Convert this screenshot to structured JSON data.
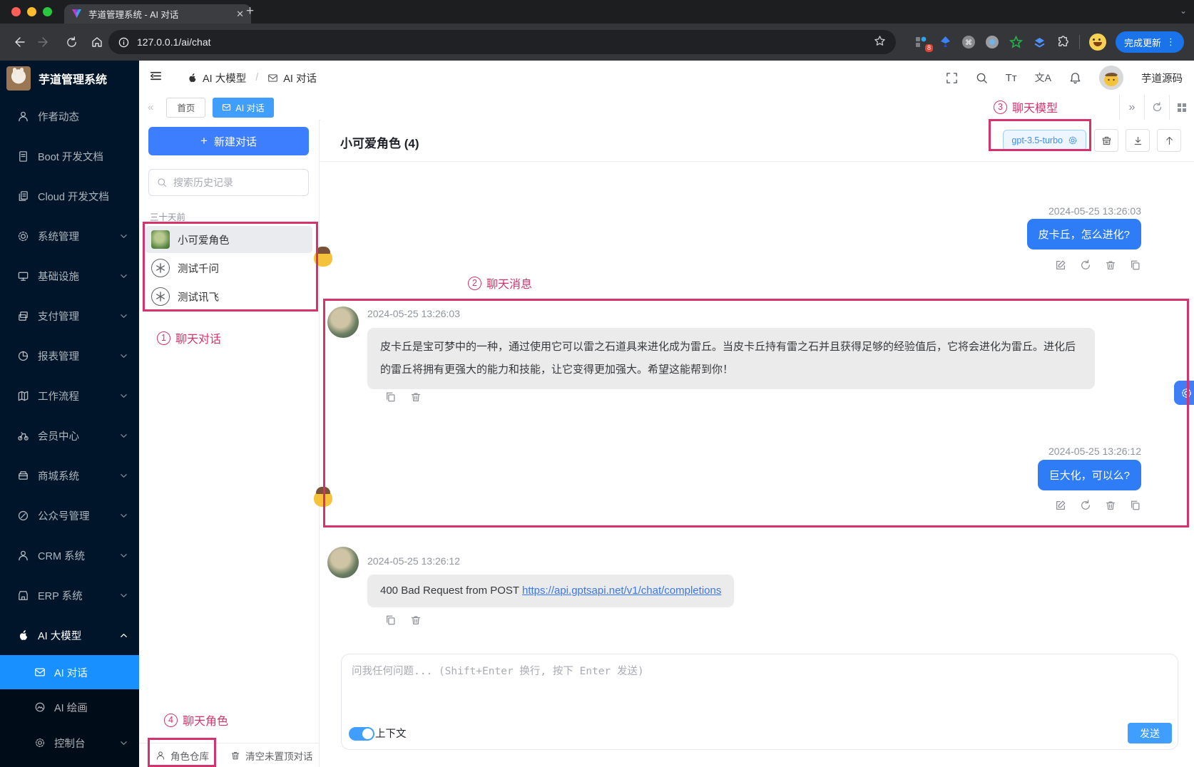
{
  "browser": {
    "tab_title": "芋道管理系统 - AI 对话",
    "url": "127.0.0.1/ai/chat",
    "update_button": "完成更新",
    "extension_badge": "8"
  },
  "sidebar": {
    "logo_title": "芋道管理系统",
    "items": [
      {
        "label": "作者动态"
      },
      {
        "label": "Boot 开发文档"
      },
      {
        "label": "Cloud 开发文档"
      },
      {
        "label": "系统管理"
      },
      {
        "label": "基础设施"
      },
      {
        "label": "支付管理"
      },
      {
        "label": "报表管理"
      },
      {
        "label": "工作流程"
      },
      {
        "label": "会员中心"
      },
      {
        "label": "商城系统"
      },
      {
        "label": "公众号管理"
      },
      {
        "label": "CRM 系统"
      },
      {
        "label": "ERP 系统"
      },
      {
        "label": "AI 大模型"
      }
    ],
    "submenu": [
      {
        "label": "AI 对话"
      },
      {
        "label": "AI 绘画"
      },
      {
        "label": "控制台"
      }
    ]
  },
  "header": {
    "breadcrumb_parent": "AI 大模型",
    "breadcrumb_current": "AI 对话",
    "username": "芋道源码"
  },
  "tagbar": {
    "tab_home": "首页",
    "tab_chat": "AI 对话"
  },
  "chat_panel": {
    "new_chat_label": "新建对话",
    "search_placeholder": "搜索历史记录",
    "group_label": "三十天前",
    "conversations": [
      {
        "name": "小可爱角色"
      },
      {
        "name": "测试千问"
      },
      {
        "name": "测试讯飞"
      }
    ],
    "role_store_label": "角色仓库",
    "clear_label": "清空未置顶对话"
  },
  "main": {
    "title": "小可爱角色 (4)",
    "model_label": "gpt-3.5-turbo",
    "messages": [
      {
        "role": "user",
        "time": "2024-05-25 13:26:03",
        "text": "皮卡丘，怎么进化?"
      },
      {
        "role": "assistant",
        "time": "2024-05-25 13:26:03",
        "text": "皮卡丘是宝可梦中的一种，通过使用它可以雷之石道具来进化成为雷丘。当皮卡丘持有雷之石并且获得足够的经验值后，它将会进化为雷丘。进化后的雷丘将拥有更强大的能力和技能，让它变得更加强大。希望这能帮到你！"
      },
      {
        "role": "user",
        "time": "2024-05-25 13:26:12",
        "text": "巨大化，可以么?"
      },
      {
        "role": "assistant",
        "time": "2024-05-25 13:26:12",
        "text_prefix": "400 Bad Request from POST ",
        "link": "https://api.gptsapi.net/v1/chat/completions"
      }
    ],
    "input_placeholder": "问我任何问题... (Shift+Enter 换行, 按下 Enter 发送)",
    "context_label": "上下文",
    "send_label": "发送"
  },
  "annotations": [
    {
      "num": "1",
      "label": "聊天对话"
    },
    {
      "num": "2",
      "label": "聊天消息"
    },
    {
      "num": "3",
      "label": "聊天模型"
    },
    {
      "num": "4",
      "label": "聊天角色"
    }
  ],
  "colors": {
    "primary": "#409eff",
    "bubble_blue": "#2e7cf6",
    "sidebar_bg": "#001529",
    "sidebar_active": "#1890ff",
    "annotation_pink": "#d6336c",
    "update_pill": "#1a73e8"
  }
}
